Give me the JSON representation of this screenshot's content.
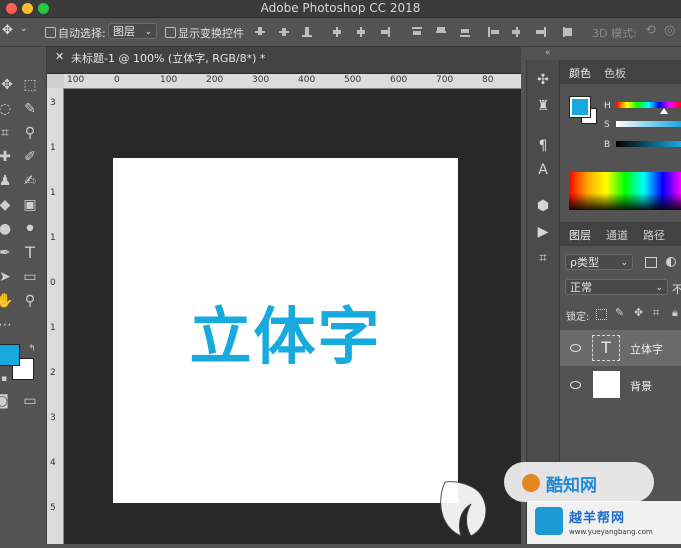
{
  "window": {
    "title": "Adobe Photoshop CC 2018",
    "traffic_colors": [
      "#fe5f57",
      "#febc2e",
      "#28c840"
    ]
  },
  "options_bar": {
    "auto_select_label": "自动选择:",
    "auto_select_value": "图层",
    "show_transform_label": "显示变换控件",
    "mode_3d_label": "3D 模式:"
  },
  "document": {
    "tab_title": "未标题-1 @ 100% (立体字, RGB/8*) *",
    "close_glyph": "✕",
    "art_text": "立体字",
    "art_color": "#18a9de"
  },
  "rulers": {
    "h_labels": [
      "100",
      "0",
      "100",
      "200",
      "300",
      "400",
      "500",
      "600",
      "700",
      "80"
    ],
    "v_labels": [
      "3",
      "1",
      "1",
      "1",
      "0",
      "1",
      "2",
      "3",
      "4",
      "5",
      "6"
    ]
  },
  "color_panel": {
    "tabs": [
      "颜色",
      "色板"
    ],
    "foreground": "#18a9de",
    "background": "#ffffff",
    "sliders": [
      {
        "label": "H"
      },
      {
        "label": "S"
      },
      {
        "label": "B"
      }
    ]
  },
  "layers_panel": {
    "tabs": [
      "图层",
      "通道",
      "路径"
    ],
    "filter_label": "ρ类型",
    "blend_mode": "正常",
    "opacity_cut": "不",
    "lock_label": "锁定:",
    "layers": [
      {
        "name": "立体字",
        "type": "text",
        "thumb_glyph": "T",
        "selected": true
      },
      {
        "name": "背景",
        "type": "pixel",
        "selected": false
      }
    ]
  },
  "toolbar": {
    "foreground": "#18a9de",
    "background": "#ffffff"
  },
  "watermark": {
    "text": "酷知网",
    "url": "www.yueyangbang.com",
    "brand": "越羊帮网"
  }
}
